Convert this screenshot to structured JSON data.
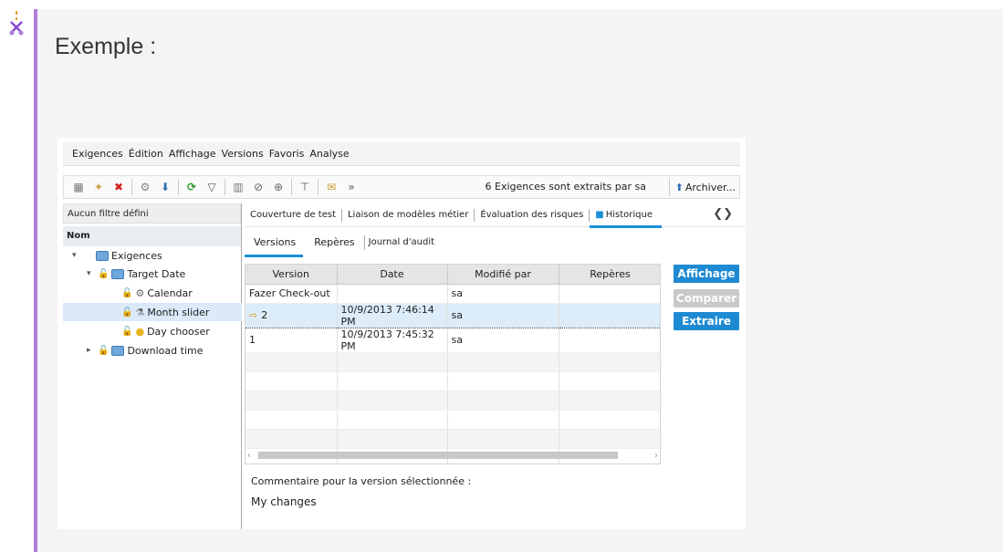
{
  "note": {
    "icon": "scissors-icon",
    "title": "Exemple :",
    "accent": "#b07fd6"
  },
  "menu": [
    "Exigences",
    "Édition",
    "Affichage",
    "Versions",
    "Favoris",
    "Analyse"
  ],
  "toolbar": {
    "status": "6 Exigences sont extraits par sa",
    "archive_label": "Archiver..."
  },
  "left": {
    "filter": "Aucun filtre défini",
    "column": "Nom",
    "tree": [
      {
        "label": "Exigences"
      },
      {
        "label": "Target Date"
      },
      {
        "label": "Calendar"
      },
      {
        "label": "Month slider"
      },
      {
        "label": "Day chooser"
      },
      {
        "label": "Download time"
      }
    ]
  },
  "tabs": [
    "Couverture de test",
    "Liaison de modèles métier",
    "Évaluation des risques",
    "Historique"
  ],
  "subtabs": [
    "Versions",
    "Repères",
    "Journal d'audit"
  ],
  "grid": {
    "columns": [
      "Version",
      "Date",
      "Modifié par",
      "Repères"
    ],
    "rows": [
      [
        "Fazer Check-out",
        "",
        "sa",
        ""
      ],
      [
        "2",
        "10/9/2013 7:46:14 PM",
        "sa",
        ""
      ],
      [
        "1",
        "10/9/2013 7:45:32 PM",
        "sa",
        ""
      ]
    ]
  },
  "buttons": {
    "view": "Affichage",
    "compare": "Comparer",
    "extract": "Extraire"
  },
  "comment": {
    "label": "Commentaire pour la version sélectionnée :",
    "value": "My changes"
  }
}
